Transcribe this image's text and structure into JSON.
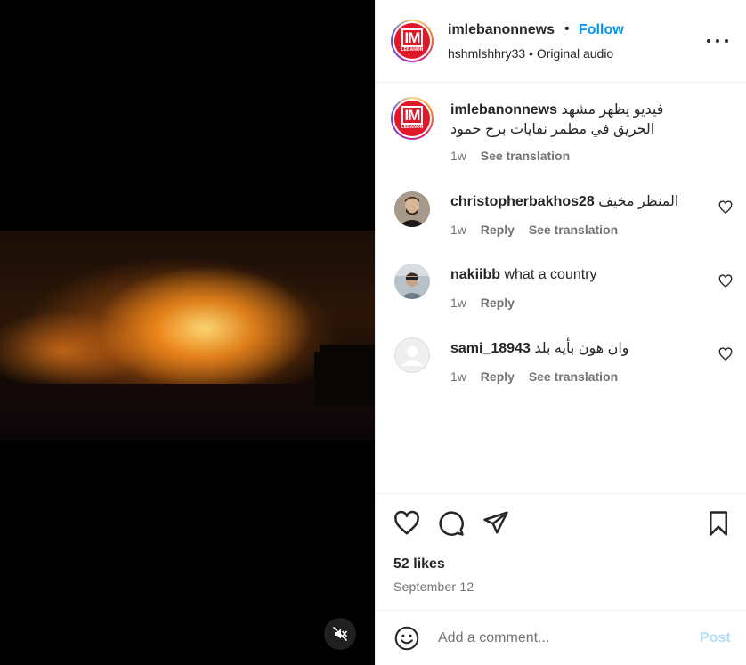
{
  "media": {
    "mute_icon": "speaker-muted-icon"
  },
  "header": {
    "avatar_text": "IM",
    "avatar_subtext": "LEBANON",
    "username": "imlebanonnews",
    "separator": "•",
    "follow_label": "Follow",
    "subline": "hshmlshhry33 • Original audio",
    "more_icon": "more-options-icon"
  },
  "caption": {
    "username": "imlebanonnews",
    "text": "فيديو يظهر مشهد الحريق في مطمر نفايات برج حمود",
    "time": "1w",
    "see_translation": "See translation"
  },
  "comments": [
    {
      "username": "christopherbakhos28",
      "text": "المنظر مخيف",
      "time": "1w",
      "reply": "Reply",
      "see_translation": "See translation"
    },
    {
      "username": "nakiibb",
      "text": "what a country",
      "time": "1w",
      "reply": "Reply"
    },
    {
      "username": "sami_18943",
      "text": "وان هون بأيه بلد",
      "time": "1w",
      "reply": "Reply",
      "see_translation": "See translation"
    }
  ],
  "actions": {
    "like_icon": "heart-icon",
    "comment_icon": "comment-icon",
    "share_icon": "share-icon",
    "save_icon": "bookmark-icon",
    "likes": "52 likes",
    "date": "September 12"
  },
  "add_comment": {
    "placeholder": "Add a comment...",
    "post_label": "Post"
  },
  "colors": {
    "follow_blue": "#0095f6",
    "post_disabled": "#b2dffc",
    "secondary_text": "#737373",
    "brand_red": "#e1182a"
  }
}
